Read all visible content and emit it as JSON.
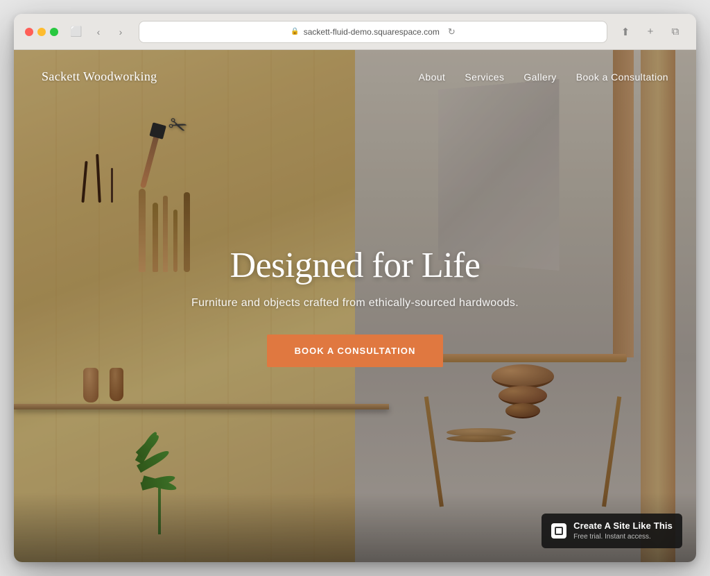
{
  "browser": {
    "url": "sackett-fluid-demo.squarespace.com",
    "back_title": "Back",
    "forward_title": "Forward"
  },
  "site": {
    "logo": "Sackett Woodworking",
    "nav": {
      "items": [
        {
          "label": "About",
          "id": "about"
        },
        {
          "label": "Services",
          "id": "services"
        },
        {
          "label": "Gallery",
          "id": "gallery"
        },
        {
          "label": "Book a Consultation",
          "id": "book-consultation"
        }
      ]
    },
    "hero": {
      "title": "Designed for Life",
      "subtitle": "Furniture and objects crafted from ethically-sourced hardwoods.",
      "cta_label": "Book a Consultation"
    },
    "badge": {
      "title": "Create A Site Like This",
      "subtitle": "Free trial. Instant access."
    }
  }
}
